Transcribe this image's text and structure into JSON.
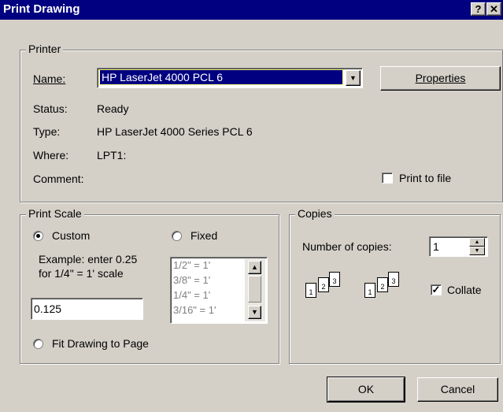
{
  "window": {
    "title": "Print Drawing",
    "help_label": "?",
    "close_label": "✕"
  },
  "printer": {
    "legend": "Printer",
    "name_label": "Name:",
    "name_value": "HP LaserJet 4000 PCL 6",
    "properties_label": "Properties",
    "status_label": "Status:",
    "status_value": "Ready",
    "type_label": "Type:",
    "type_value": "HP LaserJet 4000 Series PCL 6",
    "where_label": "Where:",
    "where_value": "LPT1:",
    "comment_label": "Comment:",
    "print_to_file_label": "Print to file",
    "print_to_file_checked": false
  },
  "print_scale": {
    "legend": "Print Scale",
    "custom_label": "Custom",
    "custom_selected": true,
    "fixed_label": "Fixed",
    "example_line1": "Example: enter 0.25",
    "example_line2": "for 1/4\" = 1' scale",
    "custom_value": "0.125",
    "fixed_options": [
      "1/2\" = 1'",
      "3/8\" = 1'",
      "1/4\" = 1'",
      "3/16\" = 1'"
    ],
    "fit_label": "Fit Drawing to Page"
  },
  "copies": {
    "legend": "Copies",
    "number_label": "Number of copies:",
    "number_value": "1",
    "collate_label": "Collate",
    "collate_checked": true,
    "page_numbers": [
      "1",
      "2",
      "3"
    ]
  },
  "buttons": {
    "ok_label": "OK",
    "cancel_label": "Cancel"
  },
  "colors": {
    "titlebar": "#000080",
    "face": "#d4d0c8",
    "selection": "#000080"
  }
}
